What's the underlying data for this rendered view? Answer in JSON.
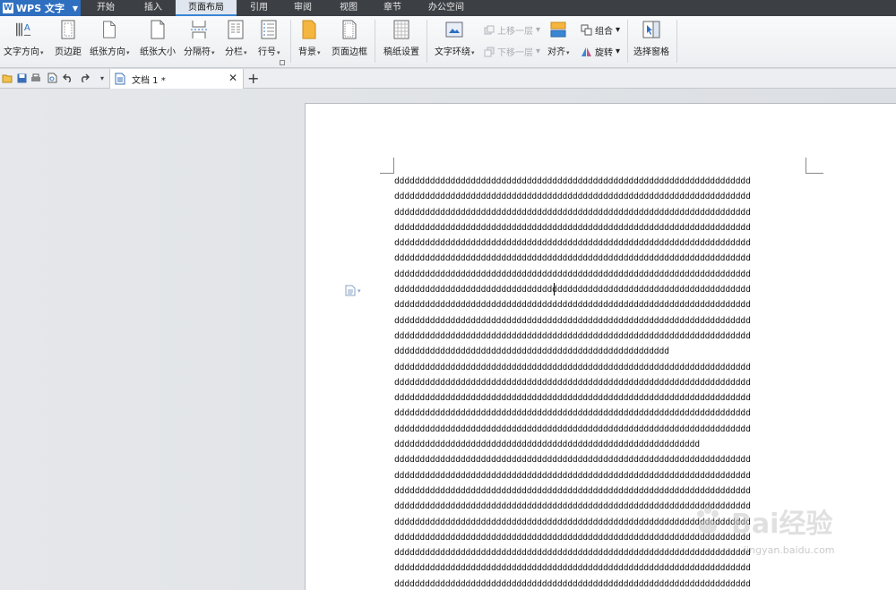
{
  "app": {
    "name": "WPS 文字",
    "logo_letter": "W"
  },
  "menu": {
    "tabs": [
      "开始",
      "插入",
      "页面布局",
      "引用",
      "审阅",
      "视图",
      "章节",
      "办公空间"
    ],
    "active": "页面布局"
  },
  "ribbon": {
    "text_direction": "文字方向",
    "margins": "页边距",
    "orientation": "纸张方向",
    "paper_size": "纸张大小",
    "breaks": "分隔符",
    "columns": "分栏",
    "line_numbers": "行号",
    "background": "背景",
    "page_border": "页面边框",
    "paper_setup": "稿纸设置",
    "text_wrap": "文字环绕",
    "bring_forward": "上移一层",
    "send_backward": "下移一层",
    "align": "对齐",
    "group": "组合",
    "rotate": "旋转",
    "selection_pane": "选择窗格"
  },
  "document_tab": {
    "title": "文档 1 *"
  },
  "document": {
    "lines": [
      "dddddddddddddddddddddddddddddddddddddddddddddddddddddddddddddddddddddd",
      "dddddddddddddddddddddddddddddddddddddddddddddddddddddddddddddddddddddd",
      "dddddddddddddddddddddddddddddddddddddddddddddddddddddddddddddddddddddd",
      "dddddddddddddddddddddddddddddddddddddddddddddddddddddddddddddddddddddd",
      "dddddddddddddddddddddddddddddddddddddddddddddddddddddddddddddddddddddd",
      "dddddddddddddddddddddddddddddddddddddddddddddddddddddddddddddddddddddd",
      "dddddddddddddddddddddddddddddddddddddddddddddddddddddddddddddddddddddd",
      "dddddddddddddddddddddddddddddddddddddddddddddddddddddddddddddddddddddd",
      "dddddddddddddddddddddddddddddddddddddddddddddddddddddddddddddddddddddd",
      "dddddddddddddddddddddddddddddddddddddddddddddddddddddddddddddddddddddd",
      "dddddddddddddddddddddddddddddddddddddddddddddddddddddddddddddddddddddd",
      "dddddddddddddddddddddddddddddddddddddddddddddddddddddd",
      "dddddddddddddddddddddddddddddddddddddddddddddddddddddddddddddddddddddd",
      "dddddddddddddddddddddddddddddddddddddddddddddddddddddddddddddddddddddd",
      "dddddddddddddddddddddddddddddddddddddddddddddddddddddddddddddddddddddd",
      "dddddddddddddddddddddddddddddddddddddddddddddddddddddddddddddddddddddd",
      "dddddddddddddddddddddddddddddddddddddddddddddddddddddddddddddddddddddd",
      "dddddddddddddddddddddddddddddddddddddddddddddddddddddddddddd",
      "dddddddddddddddddddddddddddddddddddddddddddddddddddddddddddddddddddddd",
      "dddddddddddddddddddddddddddddddddddddddddddddddddddddddddddddddddddddd",
      "dddddddddddddddddddddddddddddddddddddddddddddddddddddddddddddddddddddd",
      "dddddddddddddddddddddddddddddddddddddddddddddddddddddddddddddddddddddd",
      "dddddddddddddddddddddddddddddddddddddddddddddddddddddddddddddddddddddd",
      "dddddddddddddddddddddddddddddddddddddddddddddddddddddddddddddddddddddd",
      "dddddddddddddddddddddddddddddddddddddddddddddddddddddddddddddddddddddd",
      "dddddddddddddddddddddddddddddddddddddddddddddddddddddddddddddddddddddd",
      "dddddddddddddddddddddddddddddddddddddddddddddddddddddddddddddddddddddd"
    ]
  },
  "watermark": {
    "text": "Bai经验",
    "sub": "jingyan.baidu.com"
  },
  "colors": {
    "app_blue": "#2f6fc0",
    "menubar": "#3c3f44",
    "active_tab_accent": "#3a86d4"
  }
}
